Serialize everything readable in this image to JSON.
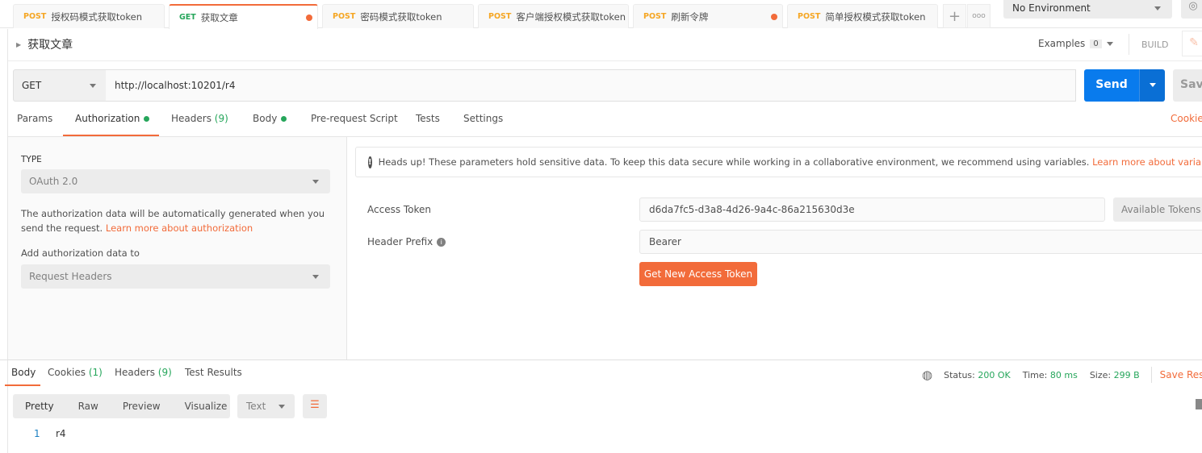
{
  "tabs": [
    {
      "method": "POST",
      "name": "授权码模式获取token",
      "dirty": false,
      "active": false
    },
    {
      "method": "GET",
      "name": "获取文章",
      "dirty": true,
      "active": true
    },
    {
      "method": "POST",
      "name": "密码模式获取token",
      "dirty": false,
      "active": false
    },
    {
      "method": "POST",
      "name": "客户端授权模式获取token",
      "dirty": false,
      "active": false
    },
    {
      "method": "POST",
      "name": "刷新令牌",
      "dirty": true,
      "active": false
    },
    {
      "method": "POST",
      "name": "简单授权模式获取token",
      "dirty": false,
      "active": false
    }
  ],
  "tab_actions": {
    "add": "+",
    "more": "ooo"
  },
  "environment": "No Environment",
  "request": {
    "title": "获取文章",
    "examples_label": "Examples",
    "examples_count": "0",
    "build_label": "BUILD",
    "method": "GET",
    "url": "http://localhost:10201/r4",
    "send_label": "Send",
    "save_label": "Save"
  },
  "request_tabs": [
    {
      "label": "Params"
    },
    {
      "label": "Authorization",
      "dot": true,
      "active": true
    },
    {
      "label": "Headers",
      "count": "(9)"
    },
    {
      "label": "Body",
      "dot": true
    },
    {
      "label": "Pre-request Script"
    },
    {
      "label": "Tests"
    },
    {
      "label": "Settings"
    }
  ],
  "cookies_link": "Cookies",
  "auth": {
    "type_label": "TYPE",
    "type_value": "OAuth 2.0",
    "description": "The authorization data will be automatically generated when you send the request. ",
    "learn_more": "Learn more about authorization",
    "add_to_label": "Add authorization data to",
    "add_to_value": "Request Headers",
    "notice": "Heads up! These parameters hold sensitive data. To keep this data secure while working in a collaborative environment, we recommend using variables.",
    "notice_link": "Learn more about variables",
    "access_token_label": "Access Token",
    "access_token": "d6da7fc5-d3a8-4d26-9a4c-86a215630d3e",
    "available_tokens": "Available Tokens",
    "header_prefix_label": "Header Prefix",
    "header_prefix": "Bearer",
    "get_token_button": "Get New Access Token"
  },
  "response": {
    "tabs": [
      {
        "label": "Body",
        "active": true
      },
      {
        "label": "Cookies",
        "count": "(1)"
      },
      {
        "label": "Headers",
        "count": "(9)"
      },
      {
        "label": "Test Results"
      }
    ],
    "status_label": "Status:",
    "status": "200 OK",
    "time_label": "Time:",
    "time": "80 ms",
    "size_label": "Size:",
    "size": "299 B",
    "save_response": "Save Response",
    "view_modes": [
      "Pretty",
      "Raw",
      "Preview",
      "Visualize"
    ],
    "format": "Text",
    "lines": [
      {
        "n": "1",
        "text": "r4"
      }
    ]
  },
  "colors": {
    "accent": "#f26b3a",
    "send": "#097bed",
    "success": "#26a65b",
    "post": "#f5a623"
  }
}
